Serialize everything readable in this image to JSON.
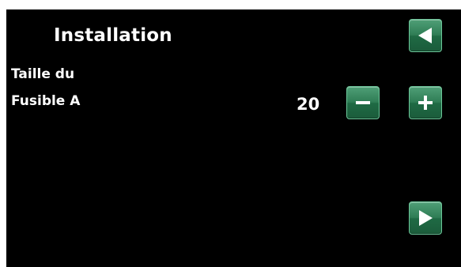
{
  "header": {
    "title": "Installation"
  },
  "setting": {
    "label_line1": "Taille du",
    "label_line2": "Fusible A",
    "value": "20"
  },
  "icons": {
    "back": "back-arrow-icon",
    "minus": "minus-icon",
    "plus": "plus-icon",
    "next": "next-arrow-icon"
  },
  "colors": {
    "background": "#000000",
    "text": "#ffffff",
    "button": "#2f7d55"
  }
}
